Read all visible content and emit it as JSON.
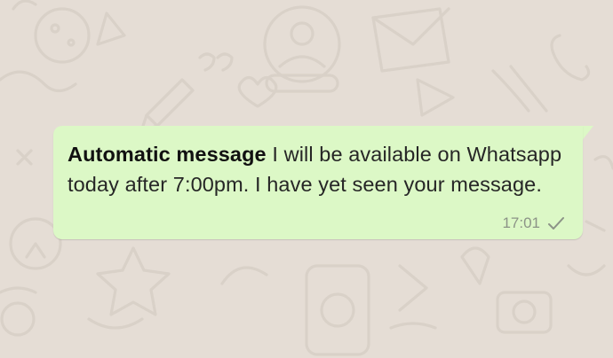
{
  "chat": {
    "wallpaper_color": "#e5ddd5",
    "message": {
      "sender": "Automatic message",
      "body": " I will be available on Whatsapp today after 7:00pm. I have yet seen your message.",
      "time": "17:01",
      "status_icon": "single-check-icon",
      "bubble_color": "#dcf8c6"
    }
  }
}
